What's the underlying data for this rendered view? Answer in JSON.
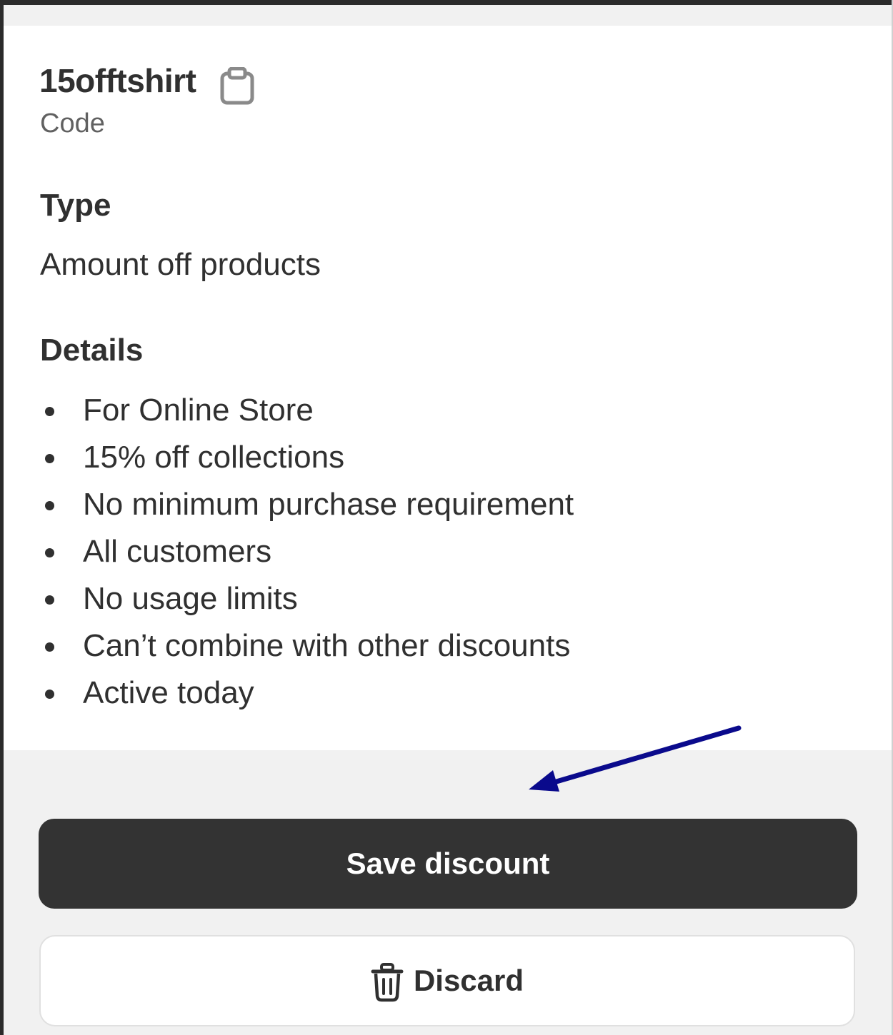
{
  "discount": {
    "code": "15offtshirt",
    "code_label": "Code",
    "copy_icon": "clipboard-icon"
  },
  "type": {
    "heading": "Type",
    "value": "Amount off products"
  },
  "details": {
    "heading": "Details",
    "items": [
      "For Online Store",
      "15% off collections",
      "No minimum purchase requirement",
      "All customers",
      "No usage limits",
      "Can’t combine with other discounts",
      "Active today"
    ]
  },
  "actions": {
    "save_label": "Save discount",
    "discard_label": "Discard",
    "discard_icon": "trash-icon"
  },
  "colors": {
    "primary_button": "#333333",
    "annotation_arrow": "#0a0a8c",
    "footer_background": "#f1f1f1"
  }
}
